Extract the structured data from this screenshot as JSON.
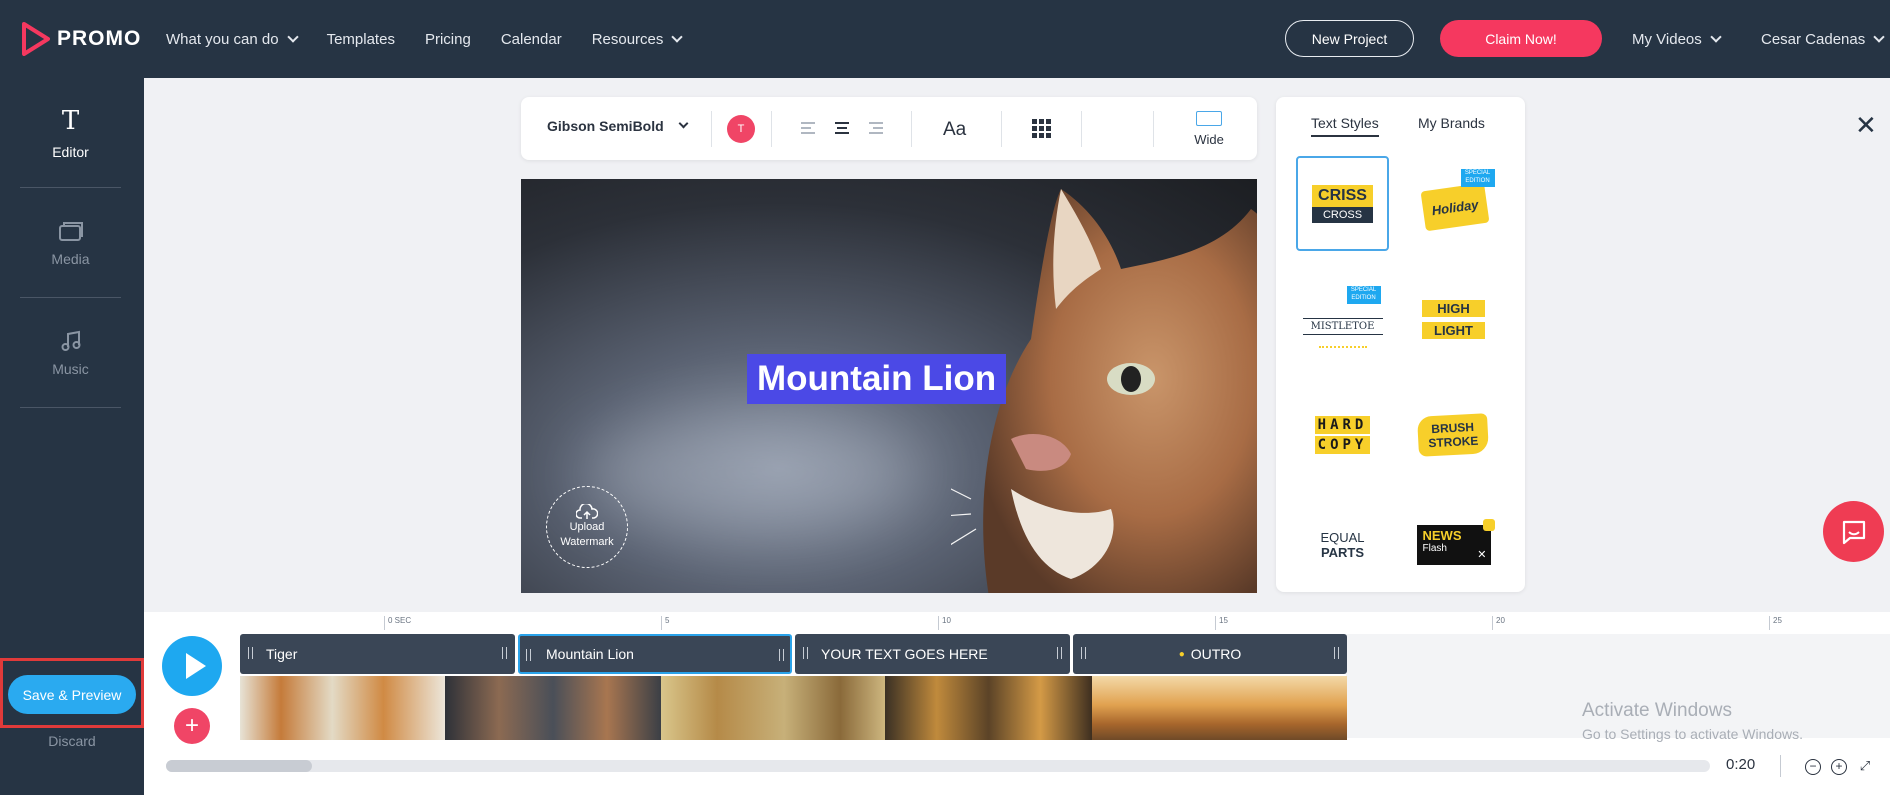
{
  "brand": {
    "name": "PROMO"
  },
  "nav": {
    "links": [
      "What you can do",
      "Templates",
      "Pricing",
      "Calendar",
      "Resources"
    ],
    "new_project": "New Project",
    "claim": "Claim Now!",
    "my_videos": "My Videos",
    "user": "Cesar Cadenas"
  },
  "sidebar": {
    "items": [
      {
        "label": "Editor",
        "icon": "text-T-icon"
      },
      {
        "label": "Media",
        "icon": "media-icon"
      },
      {
        "label": "Music",
        "icon": "music-note-icon"
      }
    ],
    "save_preview": "Save & Preview",
    "discard": "Discard"
  },
  "toolbar": {
    "font": "Gibson SemiBold",
    "color_letter": "T",
    "case_label": "Aa",
    "aspect_label": "Wide"
  },
  "stage": {
    "caption": "Mountain Lion",
    "watermark_line1": "Upload",
    "watermark_line2": "Watermark"
  },
  "styles_panel": {
    "tab_text_styles": "Text Styles",
    "tab_my_brands": "My Brands",
    "cards": [
      {
        "line1": "CRISS",
        "line2": "CROSS"
      },
      {
        "line1": "Holiday",
        "badge": "SPECIAL EDITION"
      },
      {
        "line1": "MISTLETOE",
        "badge": "SPECIAL EDITION"
      },
      {
        "line1": "HIGH",
        "line2": "LIGHT"
      },
      {
        "line1": "HARD",
        "line2": "COPY"
      },
      {
        "line1": "BRUSH",
        "line2": "STROKE"
      },
      {
        "line1": "EQUAL",
        "line2": "PARTS"
      },
      {
        "line1": "NEWS",
        "line2": "Flash"
      }
    ]
  },
  "timeline": {
    "ticks": [
      "0 SEC",
      "5",
      "10",
      "15",
      "20",
      "25"
    ],
    "scenes": [
      "Tiger",
      "Mountain Lion",
      "YOUR TEXT GOES HERE",
      "OUTRO"
    ],
    "time": "0:20"
  },
  "os_overlay": {
    "line1": "Activate Windows",
    "line2": "Go to Settings to activate Windows."
  },
  "colors": {
    "nav_bg": "#263444",
    "accent_pink": "#f5385f",
    "accent_blue": "#2aaaf0",
    "caption_bg": "#4b49e6"
  }
}
